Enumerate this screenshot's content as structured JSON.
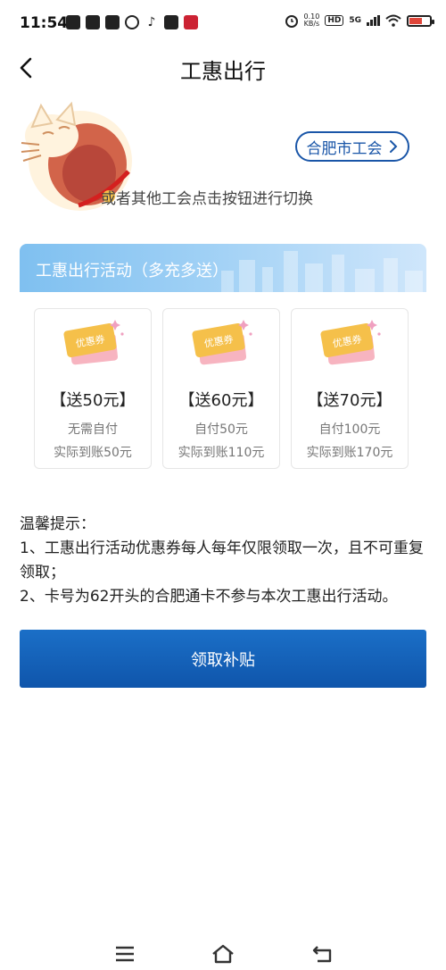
{
  "status_bar": {
    "time": "11:54",
    "net_speed_value": "0.10",
    "net_speed_unit": "KB/s",
    "hd_label": "HD",
    "network_label": "5G",
    "left_icons": [
      "app-icon",
      "mail-icon",
      "message-icon",
      "weibo-icon",
      "tiktok-icon",
      "telegram-icon",
      "app-logo-icon"
    ],
    "right_icons": [
      "alarm-icon",
      "wifi-icon",
      "battery-icon"
    ]
  },
  "nav": {
    "title": "工惠出行",
    "back_icon": "chevron-left-icon"
  },
  "org_selector": {
    "label": "合肥市工会",
    "icon": "chevron-right-icon"
  },
  "hint": "或者其他工会点击按钮进行切换",
  "activity": {
    "title": "工惠出行活动（多充多送）",
    "coupons": [
      {
        "badge": "优惠券",
        "title": "【送50元】",
        "pay": "无需自付",
        "receive": "实际到账50元"
      },
      {
        "badge": "优惠券",
        "title": "【送60元】",
        "pay": "自付50元",
        "receive": "实际到账110元"
      },
      {
        "badge": "优惠券",
        "title": "【送70元】",
        "pay": "自付100元",
        "receive": "实际到账170元"
      }
    ]
  },
  "tips": {
    "heading": "温馨提示：",
    "line1": "1、工惠出行活动优惠券每人每年仅限领取一次，且不可重复领取；",
    "line2": "2、卡号为62开头的合肥通卡不参与本次工惠出行活动。"
  },
  "claim_button": {
    "label": "领取补贴"
  },
  "system_nav": {
    "icons": [
      "menu-icon",
      "home-icon",
      "back-icon"
    ]
  },
  "colors": {
    "primary": "#1a56a8",
    "button": "#0f55ab",
    "header_light": "#9fd0f5",
    "coupon_gold": "#f5c04a",
    "coupon_pink": "#f7b4c0"
  }
}
